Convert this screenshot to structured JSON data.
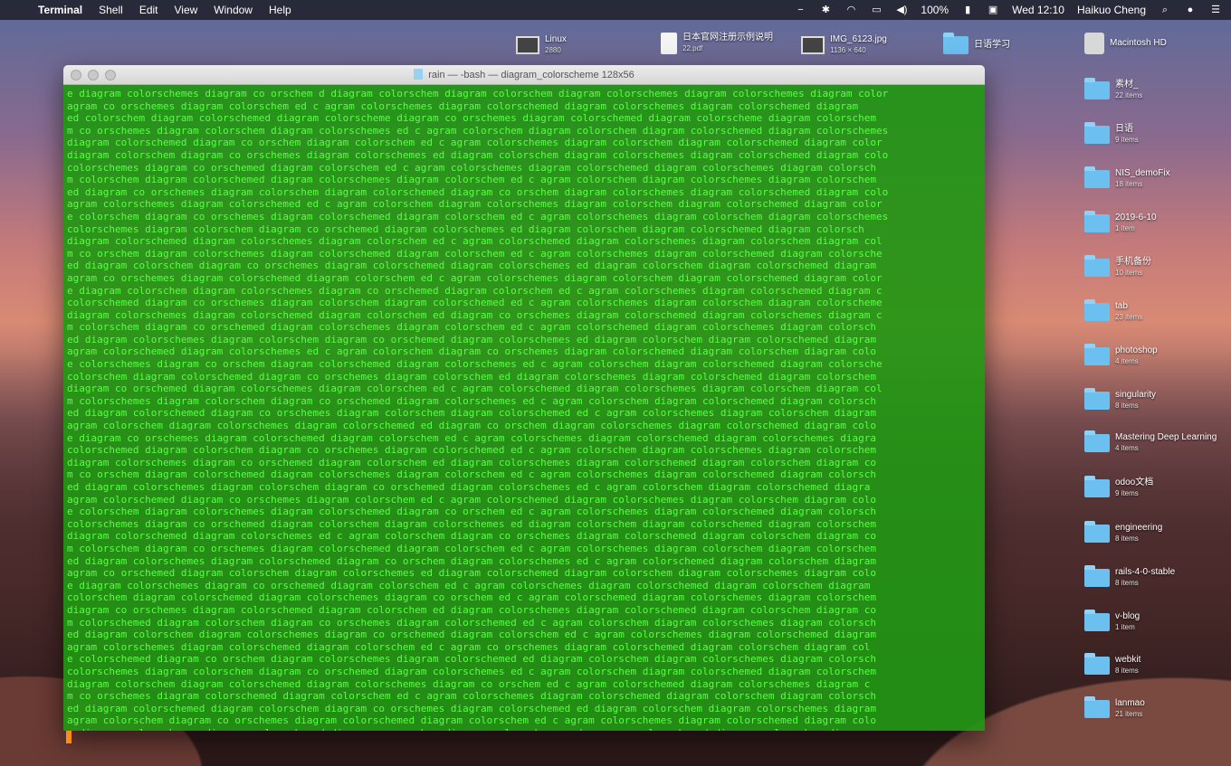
{
  "menubar": {
    "apple": "",
    "app_name": "Terminal",
    "menus": [
      "Shell",
      "Edit",
      "View",
      "Window",
      "Help"
    ],
    "battery": "100%",
    "clock": "Wed 12:10",
    "user": "Haikuo Cheng"
  },
  "desktop": {
    "top_row": [
      {
        "name": "Linux",
        "sub": "2880",
        "kind": "image"
      },
      {
        "name": "日本官网注册示例说明",
        "sub": "22.pdf",
        "kind": "file"
      },
      {
        "name": "IMG_6123.jpg",
        "sub": "1136 × 640",
        "kind": "image"
      },
      {
        "name": "日语学习",
        "sub": "",
        "kind": "folder"
      },
      {
        "name": "Macintosh HD",
        "sub": "",
        "kind": "disk"
      }
    ],
    "right_column": [
      {
        "name": "素材_",
        "sub": "22 items"
      },
      {
        "name": "日语",
        "sub": "9 items"
      },
      {
        "name": "NIS_demoFix",
        "sub": "18 items"
      },
      {
        "name": "2019-6-10",
        "sub": "1 item"
      },
      {
        "name": "手机备份",
        "sub": "10 items"
      },
      {
        "name": "tab",
        "sub": "23 items"
      },
      {
        "name": "photoshop",
        "sub": "4 items"
      },
      {
        "name": "singularity",
        "sub": "8 items"
      },
      {
        "name": "Mastering Deep Learning",
        "sub": "4 items"
      },
      {
        "name": "odoo文档",
        "sub": "9 items"
      },
      {
        "name": "engineering",
        "sub": "8 items"
      },
      {
        "name": "rails-4-0-stable",
        "sub": "8 items"
      },
      {
        "name": "v-blog",
        "sub": "1 item"
      },
      {
        "name": "webkit",
        "sub": "8 items"
      },
      {
        "name": "lanmao",
        "sub": "21 items"
      }
    ]
  },
  "terminal": {
    "title": "rain — -bash — diagram_colorscheme 128x56",
    "lines": [
      "e diagram colorschemes diagram co orschem d diagram colorschem diagram colorschem diagram colorschemes diagram colorschemes diagram color",
      "agram co orschemes diagram colorschem ed c agram colorschemes diagram colorschemed diagram colorschemes diagram colorschemed diagram",
      "ed colorschem diagram colorschemed diagram colorscheme diagram co orschemes diagram colorschemed diagram colorscheme diagram colorschem",
      "m co orschemes diagram colorschem diagram colorschemes ed c agram colorschem diagram colorschem diagram colorschemed diagram colorschemes",
      "diagram colorschemed diagram co orschem diagram colorschem ed c agram colorschemes diagram colorschem diagram colorschemed diagram color",
      "diagram colorschem diagram co orschemes diagram colorschemes ed diagram colorschem diagram colorschemes diagram colorschemed diagram colo",
      "colorschemes diagram co orschemed diagram colorschem ed c agram colorschemes diagram colorschemed diagram colorschemes diagram colorsch",
      "m colorschem diagram colorschemed diagram colorschemes diagram colorschem ed c agram colorschem diagram colorschemes diagram colorschem",
      "ed diagram co orschemes diagram colorschem diagram colorschemed diagram co orschem diagram colorschemes diagram colorschemed diagram colo",
      "agram colorschemes diagram colorschemed ed c agram colorschem diagram colorschemes diagram colorschem diagram colorschemed diagram color",
      "e colorschem diagram co orschemes diagram colorschemed diagram colorschem ed c agram colorschemes diagram colorschem diagram colorschemes",
      "colorschemes diagram colorschem diagram co orschemed diagram colorschemes ed diagram colorschem diagram colorschemed diagram colorsch",
      "diagram colorschemed diagram colorschemes diagram colorschem ed c agram colorschemed diagram colorschemes diagram colorschem diagram col",
      "m co orschem diagram colorschemes diagram colorschemed diagram colorschem ed c agram colorschemes diagram colorschemed diagram colorsche",
      "ed diagram colorschem diagram co orschemes diagram colorschemed diagram colorschemes ed diagram colorschem diagram colorschemed diagram",
      "agram co orschemes diagram colorschemed diagram colorschem ed c agram colorschemes diagram colorschem diagram colorschemed diagram color",
      "e diagram colorschem diagram colorschemes diagram co orschemed diagram colorschem ed c agram colorschemes diagram colorschemed diagram c",
      "colorschemed diagram co orschemes diagram colorschem diagram colorschemed ed c agram colorschemes diagram colorschem diagram colorscheme",
      "diagram colorschemes diagram colorschemed diagram colorschem ed diagram co orschemes diagram colorschemed diagram colorschemes diagram c",
      "m colorschem diagram co orschemed diagram colorschemes diagram colorschem ed c agram colorschemed diagram colorschemes diagram colorsch",
      "ed diagram colorschemes diagram colorschem diagram co orschemed diagram colorschemes ed diagram colorschem diagram colorschemed diagram",
      "agram colorschemed diagram colorschemes ed c agram colorschem diagram co orschemes diagram colorschemed diagram colorschem diagram colo",
      "e colorschemes diagram co orschem diagram colorschemed diagram colorschemes ed c agram colorschem diagram colorschemed diagram colorsche",
      "colorschem diagram colorschemed diagram co orschemes diagram colorschem ed diagram colorschemes diagram colorschemed diagram colorschem",
      "diagram co orschemed diagram colorschemes diagram colorschem ed c agram colorschemed diagram colorschemes diagram colorschem diagram col",
      "m colorschemes diagram colorschem diagram co orschemed diagram colorschemes ed c agram colorschem diagram colorschemed diagram colorsch",
      "ed diagram colorschemed diagram co orschemes diagram colorschem diagram colorschemed ed c agram colorschemes diagram colorschem diagram",
      "agram colorschem diagram colorschemes diagram colorschemed ed diagram co orschem diagram colorschemes diagram colorschemed diagram colo",
      "e diagram co orschemes diagram colorschemed diagram colorschem ed c agram colorschemes diagram colorschemed diagram colorschemes diagra",
      "colorschemed diagram colorschem diagram co orschemes diagram colorschemed ed c agram colorschem diagram colorschemes diagram colorschem",
      "diagram colorschemes diagram co orschemed diagram colorschem ed diagram colorschemes diagram colorschemed diagram colorschem diagram co",
      "m co orschem diagram colorschemed diagram colorschemes diagram colorschem ed c agram colorschemes diagram colorschemed diagram colorsch",
      "ed diagram colorschemes diagram colorschem diagram co orschemed diagram colorschemes ed c agram colorschem diagram colorschemed diagra",
      "agram colorschemed diagram co orschemes diagram colorschem ed c agram colorschemed diagram colorschemes diagram colorschem diagram colo",
      "e colorschem diagram colorschemes diagram colorschemed diagram co orschem ed c agram colorschemes diagram colorschemed diagram colorsch",
      "colorschemes diagram co orschemed diagram colorschem diagram colorschemes ed diagram colorschem diagram colorschemed diagram colorschem",
      "diagram colorschemed diagram colorschemes ed c agram colorschem diagram co orschemes diagram colorschemed diagram colorschem diagram co",
      "m colorschem diagram co orschemes diagram colorschemed diagram colorschem ed c agram colorschemes diagram colorschem diagram colorschem",
      "ed diagram colorschemes diagram colorschemed diagram co orschem diagram colorschemes ed c agram colorschemed diagram colorschem diagram",
      "agram co orschemed diagram colorschem diagram colorschemes ed diagram colorschemed diagram colorschem diagram colorschemes diagram colo",
      "e diagram colorschemes diagram co orschemed diagram colorschem ed c agram colorschemes diagram colorschemed diagram colorschem diagram",
      "colorschem diagram colorschemed diagram colorschemes diagram co orschem ed c agram colorschemed diagram colorschemes diagram colorschem",
      "diagram co orschemes diagram colorschemed diagram colorschem ed diagram colorschemes diagram colorschemed diagram colorschem diagram co",
      "m colorschemed diagram colorschem diagram co orschemes diagram colorschemed ed c agram colorschem diagram colorschemes diagram colorsch",
      "ed diagram colorschem diagram colorschemes diagram co orschemed diagram colorschem ed c agram colorschemes diagram colorschemed diagram",
      "agram colorschemes diagram colorschemed diagram colorschem ed c agram co orschemes diagram colorschemed diagram colorschem diagram col",
      "e colorschemed diagram co orschem diagram colorschemes diagram colorschemed ed diagram colorschem diagram colorschemes diagram colorsch",
      "colorschemes diagram colorschem diagram co orschemed diagram colorschemes ed c agram colorschem diagram colorschemed diagram colorschem",
      "diagram colorschem diagram colorschemed diagram colorschemes diagram co orschem ed c agram colorschemed diagram colorschemes diagram c",
      "m co orschemes diagram colorschemed diagram colorschem ed c agram colorschemes diagram colorschemed diagram colorschem diagram colorsch",
      "ed diagram colorschemed diagram colorschem diagram co orschemes diagram colorschemed ed diagram colorschem diagram colorschemes diagram",
      "agram colorschem diagram co orschemes diagram colorschemed diagram colorschem ed c agram colorschemes diagram colorschemed diagram colo",
      "e diagram colorschemes diagram colorschemed diagram co orschem diagram colorschemes ed c agram colorschemed diagram colorschem diagram"
    ]
  }
}
